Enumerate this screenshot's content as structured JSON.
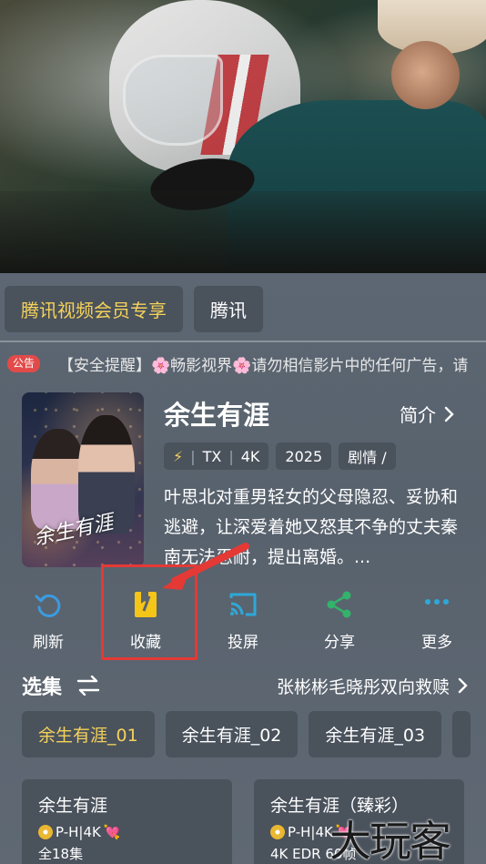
{
  "source_tabs": [
    {
      "label": "腾讯视频会员专享",
      "active": true
    },
    {
      "label": "腾讯",
      "active": false
    }
  ],
  "notice": {
    "badge": "公告",
    "text": "【安全提醒】🌸畅影视界🌸请勿相信影片中的任何广告，请"
  },
  "show": {
    "title": "余生有涯",
    "intro_label": "简介",
    "poster_title": "余生有涯",
    "tags": {
      "source": "TX",
      "quality": "4K",
      "year": "2025",
      "genre": "剧情 /"
    },
    "synopsis": "叶思北对重男轻女的父母隐忍、妥协和逃避，让深爱着她又怒其不争的丈夫秦南无法忍耐，提出离婚。..."
  },
  "actions": [
    {
      "label": "刷新",
      "icon": "refresh-icon",
      "color": "#3b9be0"
    },
    {
      "label": "收藏",
      "icon": "bookmark-icon",
      "color": "#f5c518"
    },
    {
      "label": "投屏",
      "icon": "cast-icon",
      "color": "#2fa8d8"
    },
    {
      "label": "分享",
      "icon": "share-icon",
      "color": "#33b36b"
    },
    {
      "label": "更多",
      "icon": "more-icon",
      "color": "#2fa8d8"
    }
  ],
  "episodes": {
    "title": "选集",
    "description": "张彬彬毛晓彤双向救赎",
    "tabs": [
      {
        "label": "余生有涯_01",
        "active": true
      },
      {
        "label": "余生有涯_02",
        "active": false
      },
      {
        "label": "余生有涯_03",
        "active": false
      }
    ]
  },
  "source_cards": [
    {
      "title": "余生有涯",
      "badge": "P-H|4K",
      "sub": "全18集"
    },
    {
      "title": "余生有涯（臻彩）",
      "badge": "P-H|4K",
      "sub": "4K EDR 60帧"
    }
  ],
  "watermark": "大玩客",
  "colors": {
    "accent_yellow": "#f5d25a",
    "annotation_red": "#e53935",
    "panel": "#4a525c"
  }
}
